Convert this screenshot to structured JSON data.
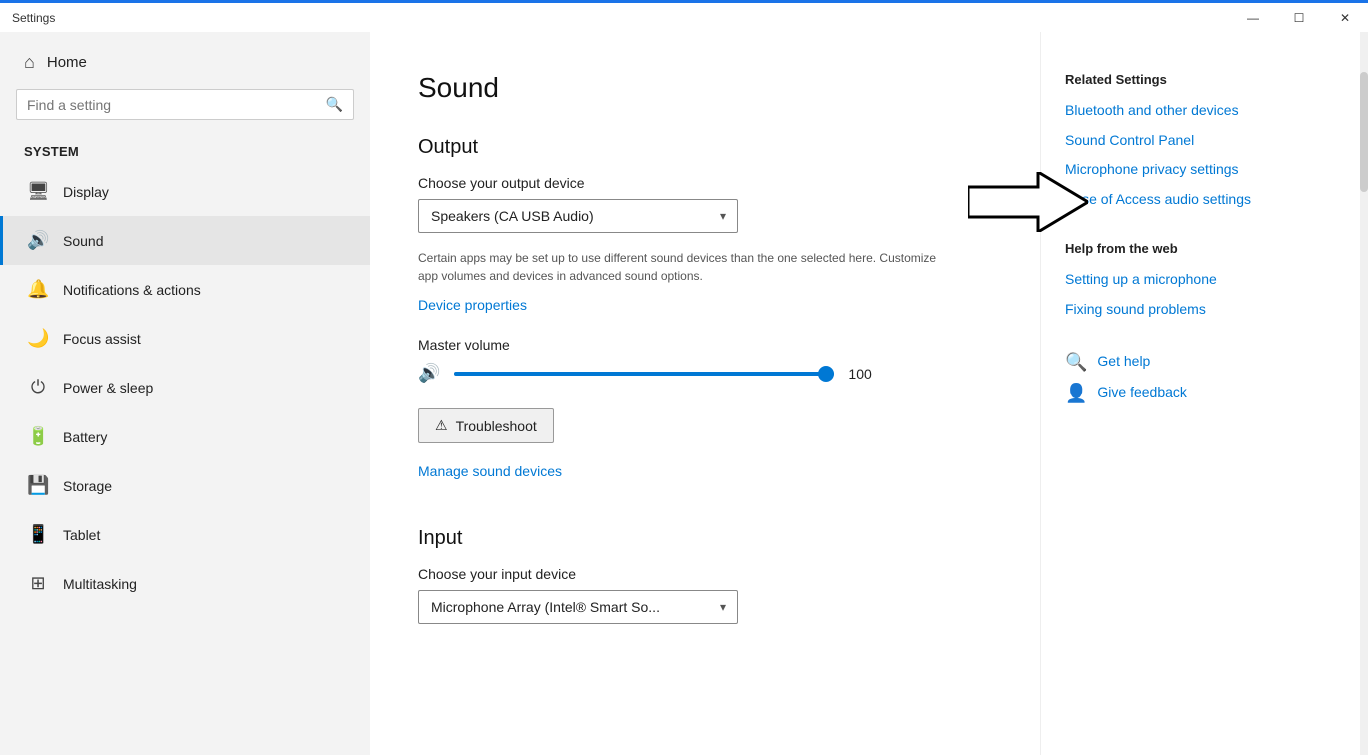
{
  "titleBar": {
    "title": "Settings",
    "minimizeLabel": "—",
    "maximizeLabel": "☐",
    "closeLabel": "✕"
  },
  "sidebar": {
    "homeLabel": "Home",
    "searchPlaceholder": "Find a setting",
    "systemLabel": "System",
    "items": [
      {
        "id": "display",
        "label": "Display",
        "icon": "🖥"
      },
      {
        "id": "sound",
        "label": "Sound",
        "icon": "🔊"
      },
      {
        "id": "notifications",
        "label": "Notifications & actions",
        "icon": "🔔"
      },
      {
        "id": "focus",
        "label": "Focus assist",
        "icon": "🌙"
      },
      {
        "id": "power",
        "label": "Power & sleep",
        "icon": "⏻"
      },
      {
        "id": "battery",
        "label": "Battery",
        "icon": "🔋"
      },
      {
        "id": "storage",
        "label": "Storage",
        "icon": "💾"
      },
      {
        "id": "tablet",
        "label": "Tablet",
        "icon": "📱"
      },
      {
        "id": "multitasking",
        "label": "Multitasking",
        "icon": "⊞"
      }
    ]
  },
  "mainContent": {
    "pageTitle": "Sound",
    "outputSection": {
      "title": "Output",
      "chooseDeviceLabel": "Choose your output device",
      "selectedDevice": "Speakers (CA USB Audio)",
      "descriptionText": "Certain apps may be set up to use different sound devices than the one selected here. Customize app volumes and devices in advanced sound options.",
      "devicePropertiesLink": "Device properties",
      "masterVolumeLabel": "Master volume",
      "volumeValue": "100",
      "volumePercent": 100,
      "troubleshootLabel": "Troubleshoot",
      "troubleshootIcon": "⚠",
      "manageSoundLink": "Manage sound devices"
    },
    "inputSection": {
      "title": "Input",
      "chooseDeviceLabel": "Choose your input device",
      "selectedDevice": "Microphone Array (Intel® Smart So..."
    }
  },
  "rightPanel": {
    "relatedSettingsTitle": "Related Settings",
    "links": [
      {
        "id": "bluetooth",
        "label": "Bluetooth and other devices"
      },
      {
        "id": "soundControlPanel",
        "label": "Sound Control Panel"
      },
      {
        "id": "micPrivacy",
        "label": "Microphone privacy settings"
      },
      {
        "id": "easeAccess",
        "label": "Ease of Access audio settings"
      }
    ],
    "helpWebTitle": "Help from the web",
    "helpLinks": [
      {
        "id": "setupMic",
        "label": "Setting up a microphone"
      },
      {
        "id": "fixSound",
        "label": "Fixing sound problems"
      }
    ],
    "getHelpLabel": "Get help",
    "giveFeedbackLabel": "Give feedback",
    "getHelpIcon": "🔍",
    "giveFeedbackIcon": "👤"
  }
}
